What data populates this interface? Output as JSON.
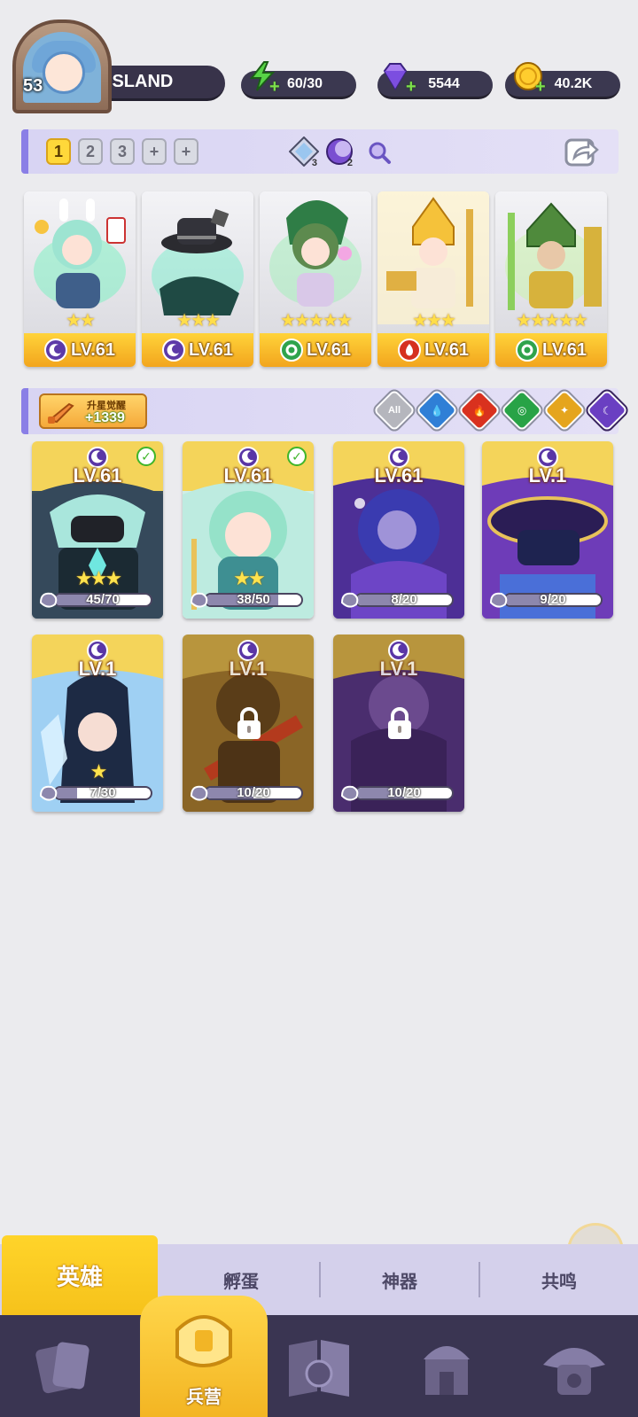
{
  "player": {
    "level": "53",
    "name": "ASLAND"
  },
  "resources": {
    "energy": "60/30",
    "gems": "5544",
    "gold": "40.2K"
  },
  "team": {
    "tabs": [
      "1",
      "2",
      "3",
      "+",
      "+"
    ],
    "active_tab": "1",
    "tokens": [
      {
        "name": "water-gem",
        "count": "3"
      },
      {
        "name": "dark-gem",
        "count": "2"
      }
    ],
    "heroes": [
      {
        "level": "LV.61",
        "stars": "★★",
        "element": "dark"
      },
      {
        "level": "LV.61",
        "stars": "★★★",
        "element": "dark"
      },
      {
        "level": "LV.61",
        "stars": "★★★★★",
        "element": "wind"
      },
      {
        "level": "LV.61",
        "stars": "★★★",
        "element": "fire"
      },
      {
        "level": "LV.61",
        "stars": "★★★★★",
        "element": "wind"
      }
    ]
  },
  "filter": {
    "awaken_title": "升星觉醒",
    "awaken_value": "+1339",
    "all_label": "All",
    "elements": [
      "water",
      "fire",
      "wind",
      "light",
      "dark"
    ]
  },
  "collection": [
    {
      "level": "LV.61",
      "stars": "★★★",
      "progress": "45/70",
      "ratio": 0.64,
      "checked": true,
      "locked": false
    },
    {
      "level": "LV.61",
      "stars": "★★",
      "progress": "38/50",
      "ratio": 0.76,
      "checked": true,
      "locked": false
    },
    {
      "level": "LV.61",
      "stars": "",
      "progress": "8/20",
      "ratio": 0.4,
      "checked": false,
      "locked": false
    },
    {
      "level": "LV.1",
      "stars": "",
      "progress": "9/20",
      "ratio": 0.45,
      "checked": false,
      "locked": false
    },
    {
      "level": "LV.1",
      "stars": "★",
      "progress": "7/30",
      "ratio": 0.23,
      "checked": false,
      "locked": false
    },
    {
      "level": "LV.1",
      "stars": "",
      "progress": "10/20",
      "ratio": 0.5,
      "checked": false,
      "locked": true
    },
    {
      "level": "LV.1",
      "stars": "",
      "progress": "10/20",
      "ratio": 0.5,
      "checked": false,
      "locked": true
    }
  ],
  "sub_tabs": [
    "英雄",
    "孵蛋",
    "神器",
    "共鸣"
  ],
  "nav": {
    "active_label": "兵营",
    "items": [
      "cards-icon",
      "barracks-icon",
      "map-book-icon",
      "shrine-icon",
      "mushroom-house-icon"
    ]
  },
  "colors": {
    "accent_yellow": "#ffd42a",
    "dark_panel": "#3a3552",
    "lavender": "#d4d0eb"
  }
}
